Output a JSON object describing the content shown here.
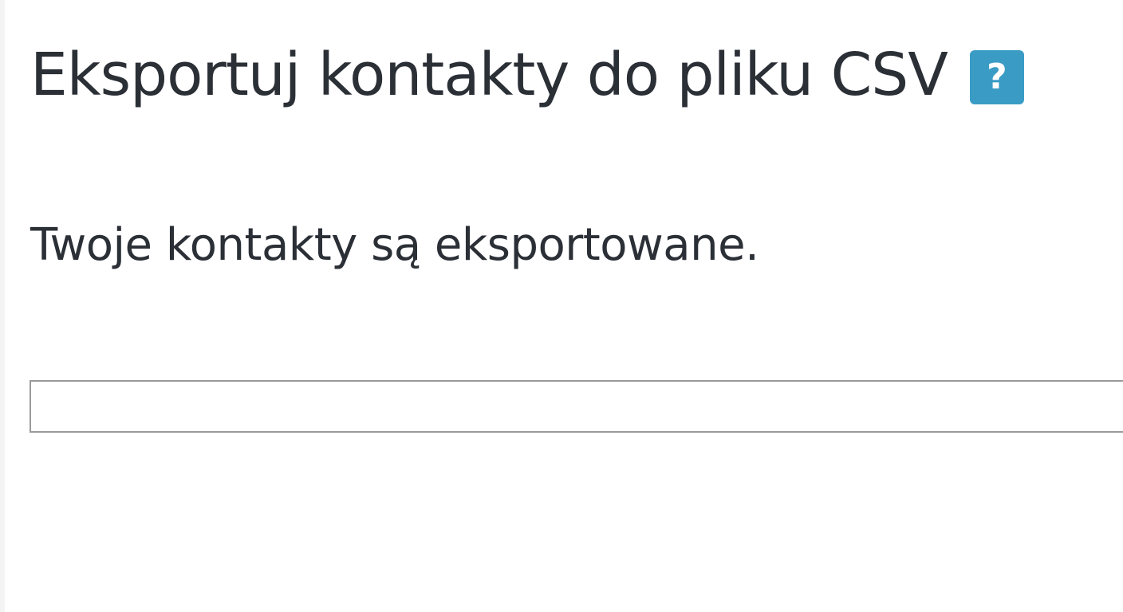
{
  "page": {
    "title": "Eksportuj kontakty do pliku CSV",
    "help_icon": "question-mark-icon",
    "help_glyph": "?",
    "help_color": "#3a9cc5"
  },
  "status": {
    "message": "Twoje kontakty są eksportowane."
  },
  "progress": {
    "value_percent": 0
  }
}
